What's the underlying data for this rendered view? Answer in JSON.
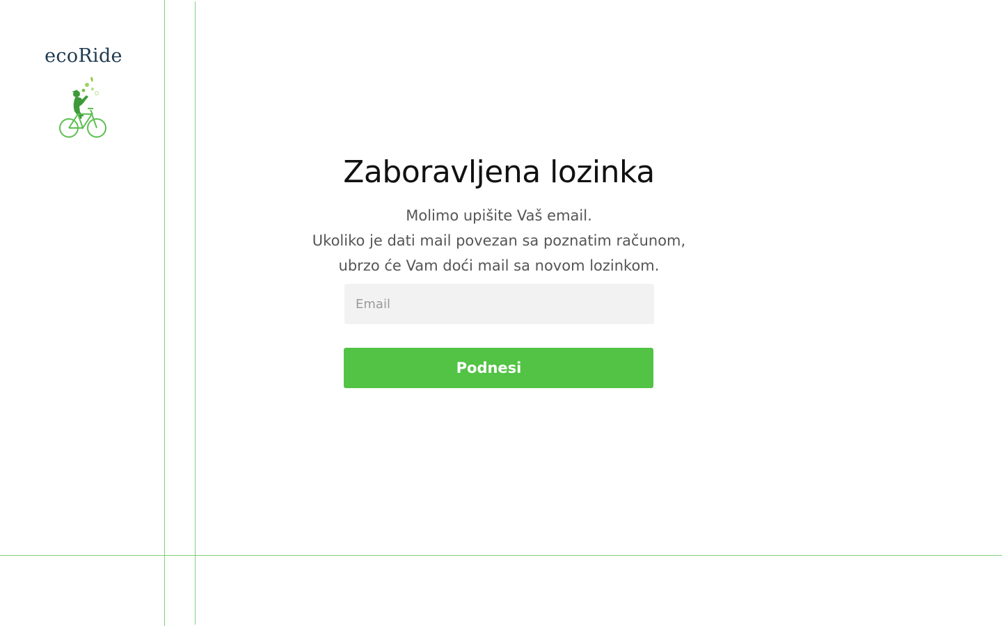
{
  "brand": {
    "name": "ecoRide",
    "logo_icon": "cyclist-icon",
    "text_color": "#1f3a4f",
    "accent_color": "#52c345"
  },
  "form": {
    "title": "Zaboravljena lozinka",
    "description_lines": [
      "Molimo upišite Vaš email.",
      "Ukoliko je dati mail povezan sa poznatim računom,",
      "ubrzo će Vam doći mail sa novom lozinkom."
    ],
    "email": {
      "placeholder": "Email",
      "value": ""
    },
    "submit_label": "Podnesi",
    "submit_color": "#52c345"
  }
}
